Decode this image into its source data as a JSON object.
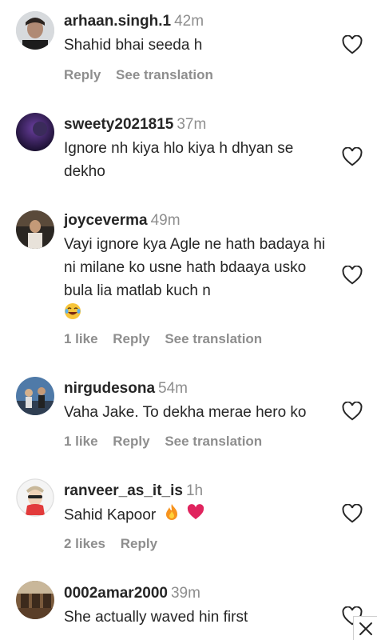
{
  "comments": [
    {
      "username": "arhaan.singh.1",
      "time": "42m",
      "text": "Shahid bhai seeda h",
      "likes": "",
      "reply": "Reply",
      "translation": "See translation"
    },
    {
      "username": "sweety2021815",
      "time": "37m",
      "text": "Ignore nh kiya hlo kiya h dhyan se dekho",
      "likes": "",
      "reply": "",
      "translation": ""
    },
    {
      "username": "joyceverma",
      "time": "49m",
      "text": "Vayi ignore kya Agle ne hath badaya hi ni milane ko usne hath bdaaya usko bula lia matlab kuch n",
      "likes": "1 like",
      "reply": "Reply",
      "translation": "See translation"
    },
    {
      "username": "nirgudesona",
      "time": "54m",
      "text": "Vaha Jake. To dekha merae hero ko",
      "likes": "1 like",
      "reply": "Reply",
      "translation": "See translation"
    },
    {
      "username": "ranveer_as_it_is",
      "time": "1h",
      "text": "Sahid Kapoor",
      "likes": "2 likes",
      "reply": "Reply",
      "translation": ""
    },
    {
      "username": "0002amar2000",
      "time": "39m",
      "text": "She actually waved hin first",
      "likes": "",
      "reply": "",
      "translation": ""
    }
  ],
  "icons": {
    "like": "heart-outline-icon",
    "close": "close-icon",
    "laugh_emoji": "laughing-face-emoji",
    "fire_emoji": "fire-emoji",
    "heart_emoji": "red-heart-emoji"
  },
  "colors": {
    "text": "#262626",
    "secondary": "#8e8e8e",
    "red_heart": "#e0245e"
  }
}
